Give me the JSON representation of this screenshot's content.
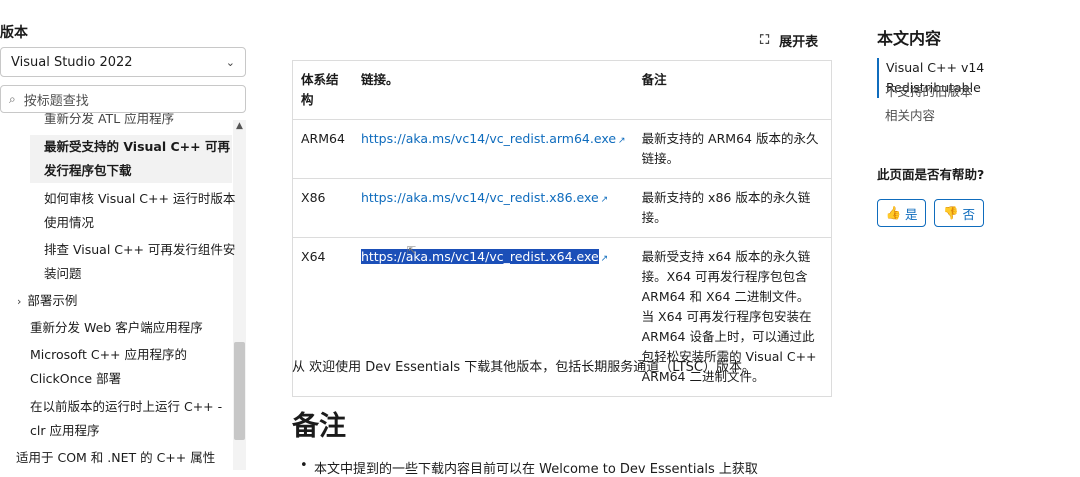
{
  "left": {
    "title": "版本",
    "version_select": "Visual Studio 2022",
    "filter_placeholder": "按标题查找",
    "toc": [
      {
        "label": "重新分发 ATL 应用程序"
      },
      {
        "label": "最新受支持的 Visual C++ 可再"
      },
      {
        "label": "发行程序包下载"
      },
      {
        "label": "如何审核 Visual C++ 运行时版本"
      },
      {
        "label": "使用情况"
      },
      {
        "label": "排查 Visual C++ 可再发行组件安"
      },
      {
        "label": "装问题"
      },
      {
        "label": "部署示例"
      },
      {
        "label": "重新分发 Web 客户端应用程序"
      },
      {
        "label": "Microsoft C++ 应用程序的"
      },
      {
        "label": "ClickOnce 部署"
      },
      {
        "label": "在以前版本的运行时上运行 C++ -"
      },
      {
        "label": "clr 应用程序"
      },
      {
        "label": "适用于 COM 和 .NET 的 C++ 属性"
      }
    ]
  },
  "main": {
    "expand_label": "展开表",
    "table": {
      "headers": [
        "体系结构",
        "链接。",
        "备注"
      ],
      "rows": [
        {
          "arch": "ARM64",
          "link": "https://aka.ms/vc14/vc_redist.arm64.exe",
          "note": "最新支持的 ARM64 版本的永久链接。"
        },
        {
          "arch": "X86",
          "link": "https://aka.ms/vc14/vc_redist.x86.exe",
          "note": "最新支持的 x86 版本的永久链接。"
        },
        {
          "arch": "X64",
          "link": "https://aka.ms/vc14/vc_redist.x64.exe",
          "note": "最新受支持 x64 版本的永久链接。X64 可再发行程序包包含 ARM64 和 X64 二进制文件。 当 X64 可再发行程序包安装在 ARM64 设备上时，可以通过此包轻松安装所需的 Visual C++ ARM64 二进制文件。"
        }
      ]
    },
    "from_text": "从 欢迎使用 Dev Essentials 下载其他版本，包括长期服务通道（LTSC）版本。",
    "notes_heading": "备注",
    "bullet_text": "本文中提到的一些下载内容目前可以在 Welcome to Dev Essentials 上获取"
  },
  "right": {
    "title": "本文内容",
    "links": [
      "Visual C++ v14 Redistributable",
      "不支持的旧版本",
      "相关内容"
    ],
    "help_title": "此页面是否有帮助?",
    "yes_label": "是",
    "no_label": "否"
  }
}
